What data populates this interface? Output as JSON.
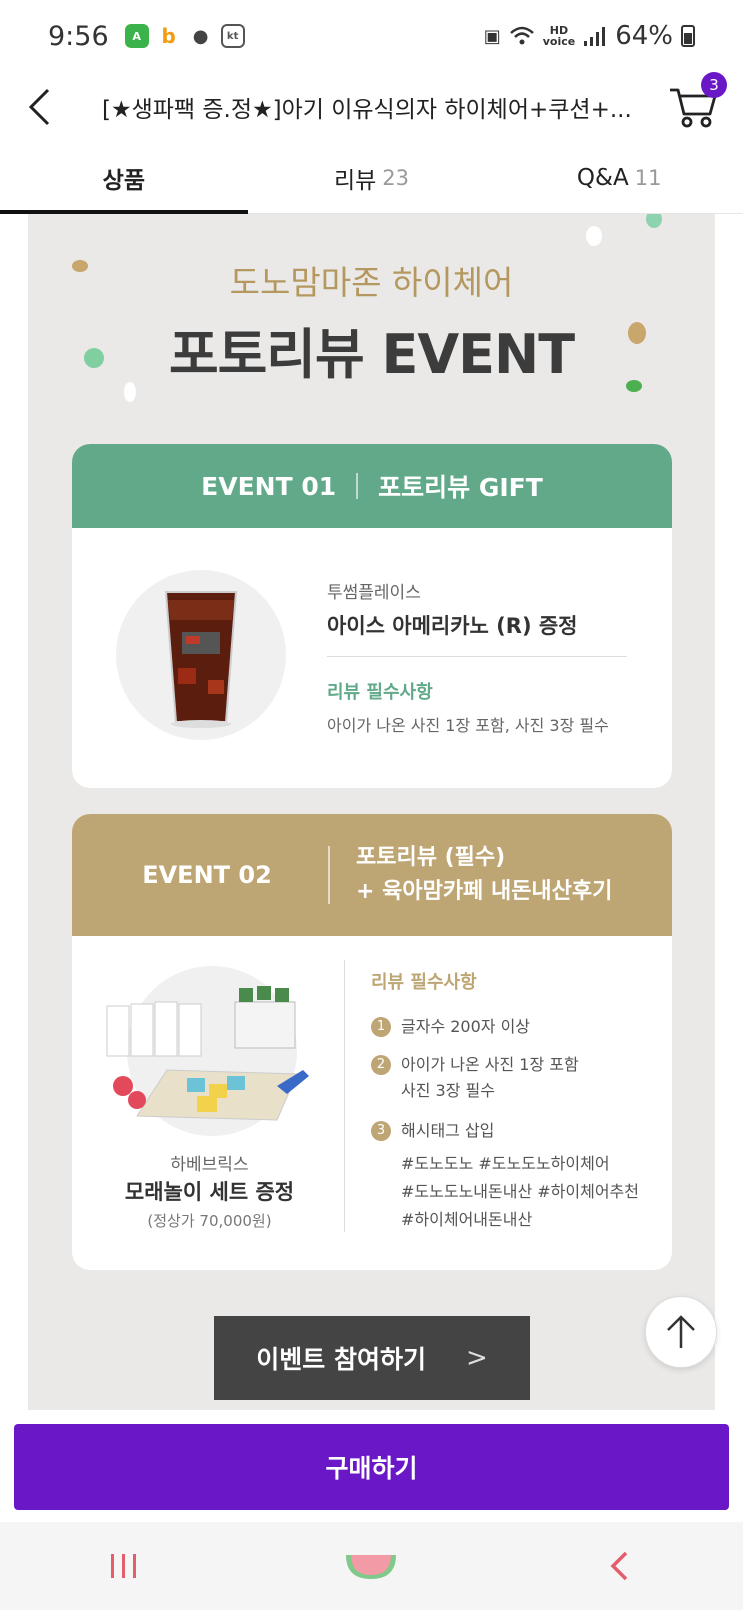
{
  "status_bar": {
    "time": "9:56",
    "battery": "64%",
    "hd_label": "HD",
    "voice_label": "voice"
  },
  "header": {
    "title": "[★생파팩 증.정★]아기 이유식의자 하이체어+쿠션+...",
    "cart_count": "3"
  },
  "tabs": [
    {
      "label": "상품",
      "count": ""
    },
    {
      "label": "리뷰",
      "count": "23"
    },
    {
      "label": "Q&A",
      "count": "11"
    }
  ],
  "event": {
    "subtitle": "도노맘마존 하이체어",
    "title": "포토리뷰 EVENT",
    "event1": {
      "num": "EVENT 01",
      "name": "포토리뷰 GIFT",
      "brand": "투썸플레이스",
      "gift": "아이스 아메리카노 (R) 증정",
      "req_title": "리뷰 필수사항",
      "req": "아이가 나온 사진 1장 포함, 사진 3장 필수"
    },
    "event2": {
      "num": "EVENT 02",
      "line1": "포토리뷰 (필수)",
      "line2": "+ 육아맘카페 내돈내산후기",
      "brand": "하베브릭스",
      "gift": "모래놀이 세트 증정",
      "price": "(정상가 70,000원)",
      "req_title": "리뷰 필수사항",
      "items": [
        {
          "num": "1",
          "text": "글자수 200자 이상"
        },
        {
          "num": "2",
          "text": "아이가 나온 사진 1장 포함"
        },
        {
          "num": "3",
          "text": "해시태그 삽입"
        }
      ],
      "item2_line2": "사진 3장 필수",
      "hashtags": [
        "#도노도노 #도노도노하이체어",
        "#도노도노내돈내산 #하이체어추천",
        "#하이체어내돈내산"
      ]
    },
    "join_label": "이벤트 참여하기",
    "join_arrow": ">"
  },
  "buy_label": "구매하기",
  "colors": {
    "accent": "#6a18c7",
    "event1": "#62a98a",
    "event2": "#bea574"
  },
  "icons": [
    "back-icon",
    "cart-icon",
    "scroll-top-icon",
    "recent-apps-icon",
    "home-icon",
    "nav-back-icon"
  ]
}
